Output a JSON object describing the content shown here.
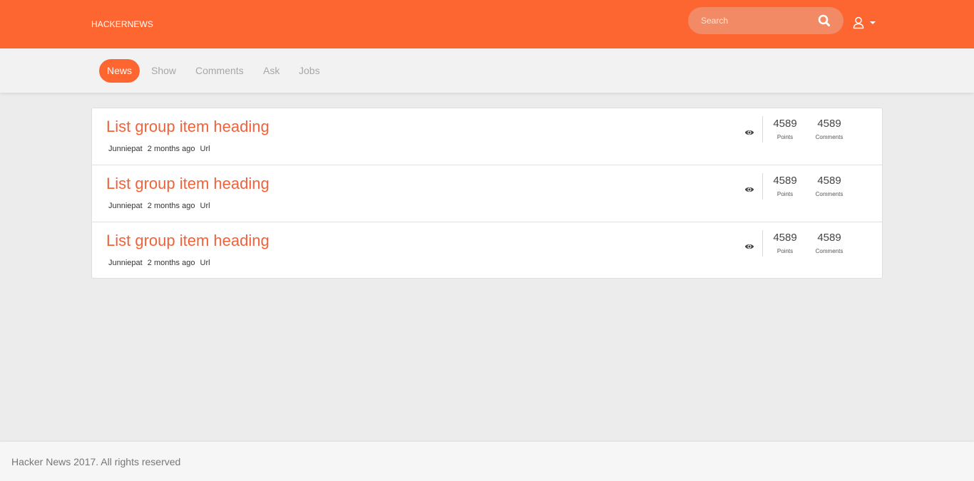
{
  "header": {
    "brand": "HACKERNEWS",
    "search": {
      "placeholder": "Search",
      "icon": "search-icon"
    },
    "user_menu": {
      "icon": "user-icon",
      "caret_icon": "caret-down-icon"
    },
    "accent_color": "#fd6631"
  },
  "nav": {
    "tabs": [
      {
        "label": "News",
        "active": true
      },
      {
        "label": "Show",
        "active": false
      },
      {
        "label": "Comments",
        "active": false
      },
      {
        "label": "Ask",
        "active": false
      },
      {
        "label": "Jobs",
        "active": false
      }
    ]
  },
  "items": [
    {
      "title": "List group item heading",
      "author": "Junniepat",
      "time": "2 months ago",
      "url_label": "Url",
      "points": "4589",
      "points_label": "Points",
      "comments": "4589",
      "comments_label": "Comments"
    },
    {
      "title": "List group item heading",
      "author": "Junniepat",
      "time": "2 months ago",
      "url_label": "Url",
      "points": "4589",
      "points_label": "Points",
      "comments": "4589",
      "comments_label": "Comments"
    },
    {
      "title": "List group item heading",
      "author": "Junniepat",
      "time": "2 months ago",
      "url_label": "Url",
      "points": "4589",
      "points_label": "Points",
      "comments": "4589",
      "comments_label": "Comments"
    }
  ],
  "footer": {
    "text": "Hacker News 2017. All rights reserved"
  }
}
